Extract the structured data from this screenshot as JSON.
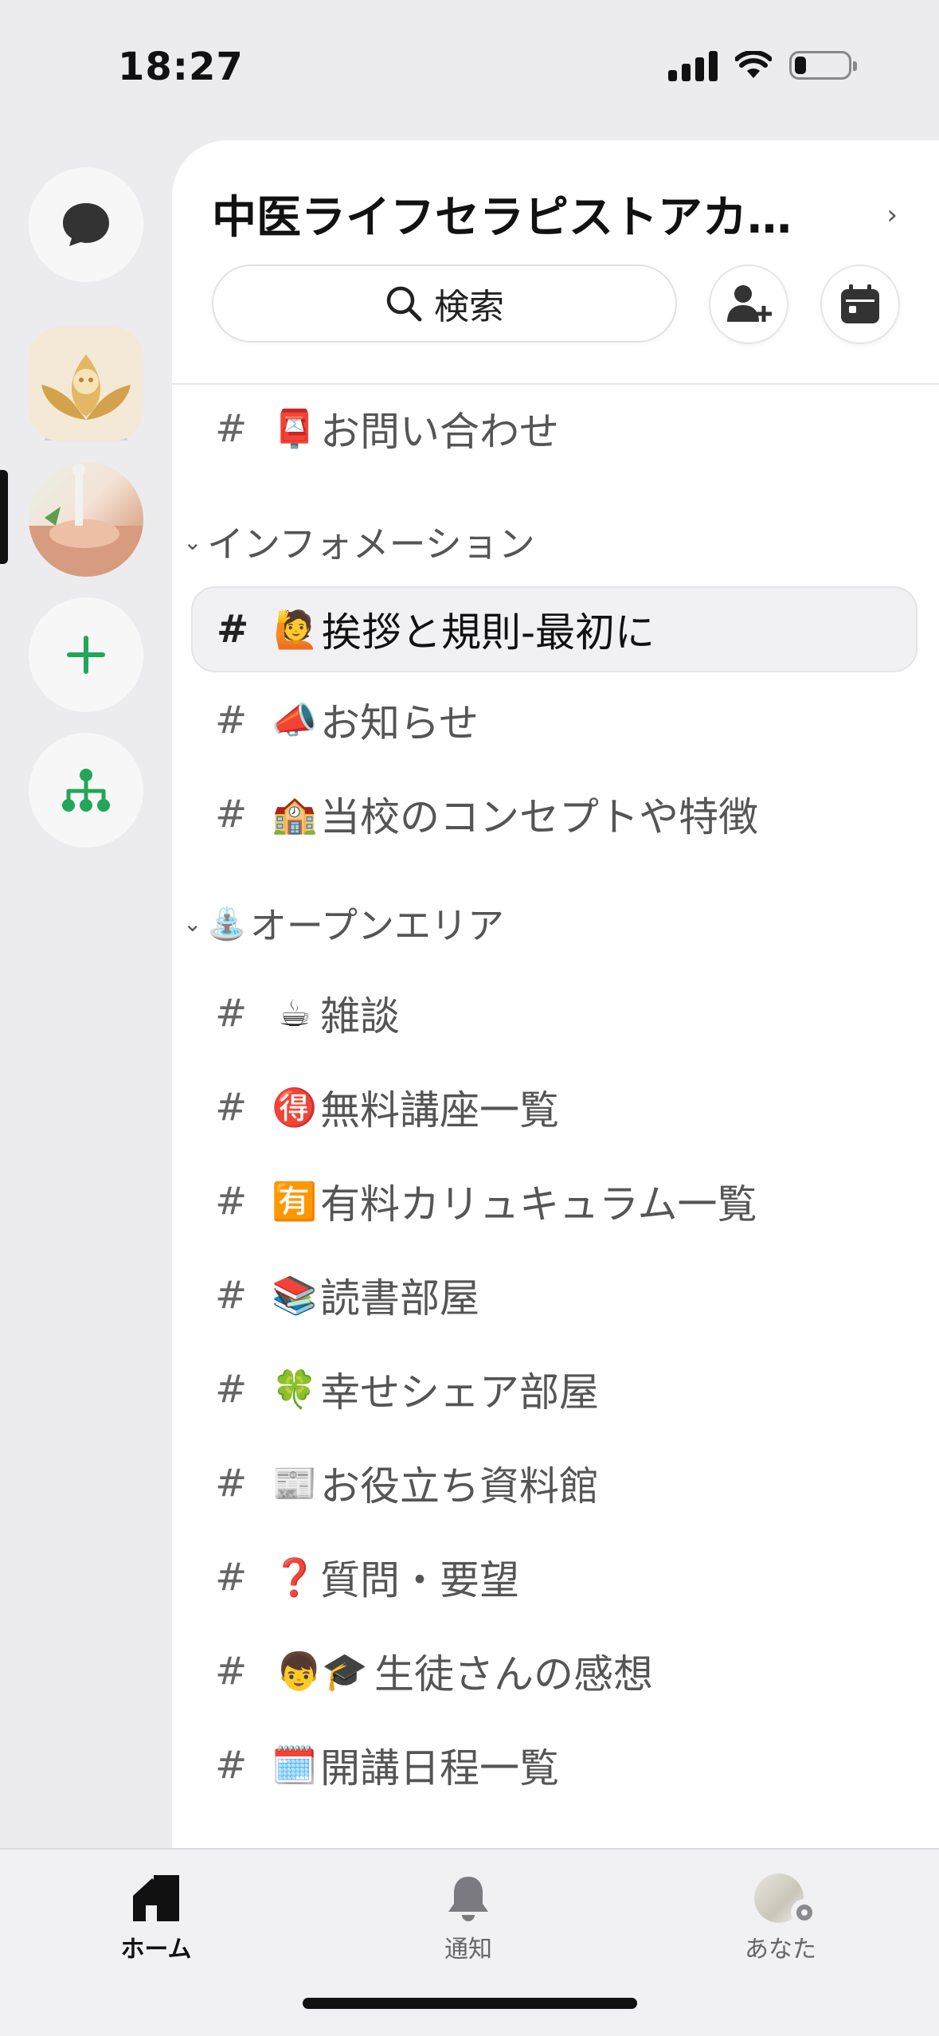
{
  "status_bar": {
    "time": "18:27"
  },
  "server": {
    "title": "中医ライフセラピストアカ…"
  },
  "search": {
    "label": "検索"
  },
  "channels_top": [
    {
      "emoji": "📮",
      "name": "お問い合わせ"
    }
  ],
  "categories": [
    {
      "emoji": "",
      "name": "インフォメーション",
      "channels": [
        {
          "emoji": "🙋",
          "name": "挨拶と規則-最初に",
          "selected": true
        },
        {
          "emoji": "📣",
          "name": "お知らせ"
        },
        {
          "emoji": "🏫",
          "name": "当校のコンセプトや特徴"
        }
      ]
    },
    {
      "emoji": "⛲",
      "name": "オープンエリア",
      "channels": [
        {
          "emoji": "☕",
          "name": "雑談"
        },
        {
          "emoji": "🉐",
          "name": "無料講座一覧"
        },
        {
          "emoji": "🈶",
          "name": "有料カリュキュラム一覧"
        },
        {
          "emoji": "📚",
          "name": "読書部屋"
        },
        {
          "emoji": "🍀",
          "name": "幸せシェア部屋"
        },
        {
          "emoji": "📰",
          "name": "お役立ち資料館"
        },
        {
          "emoji": "❓",
          "name": "質問・要望"
        },
        {
          "emoji": "👦🎓",
          "name": "生徒さんの感想"
        },
        {
          "emoji": "🗓️",
          "name": "開講日程一覧"
        }
      ]
    }
  ],
  "tabs": [
    {
      "label": "ホーム",
      "icon": "home-icon",
      "active": true
    },
    {
      "label": "通知",
      "icon": "bell-icon"
    },
    {
      "label": "あなた",
      "icon": "avatar"
    }
  ],
  "colors": {
    "accent": "#23A55A",
    "selected_bg": "#F1F1F3"
  }
}
